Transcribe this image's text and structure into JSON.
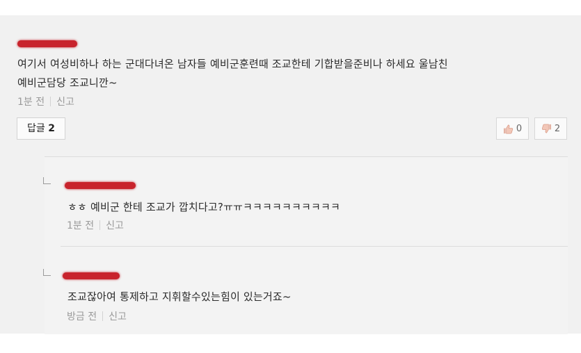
{
  "comment": {
    "text_line1": "여기서 여성비하나 하는 군대다녀온 남자들 예비군훈련때 조교한테 기합받을준비나 하세요 울남친",
    "text_line2": "예비군담당 조교니깐~",
    "time": "1분 전",
    "report": "신고",
    "reply_label": "답글",
    "reply_count": "2",
    "like_count": "0",
    "dislike_count": "2"
  },
  "replies": [
    {
      "text": "ㅎㅎ 예비군 한테 조교가 깝치다고?ㅠㅠㅋㅋㅋㅋㅋㅋㅋㅋㅋㅋ",
      "time": "1분 전",
      "report": "신고"
    },
    {
      "text": "조교잖아여 통제하고 지휘할수있는힘이 있는거죠~",
      "time": "방금 전",
      "report": "신고"
    }
  ],
  "colors": {
    "redaction": "#c8232c",
    "background": "#f1f1f1"
  }
}
